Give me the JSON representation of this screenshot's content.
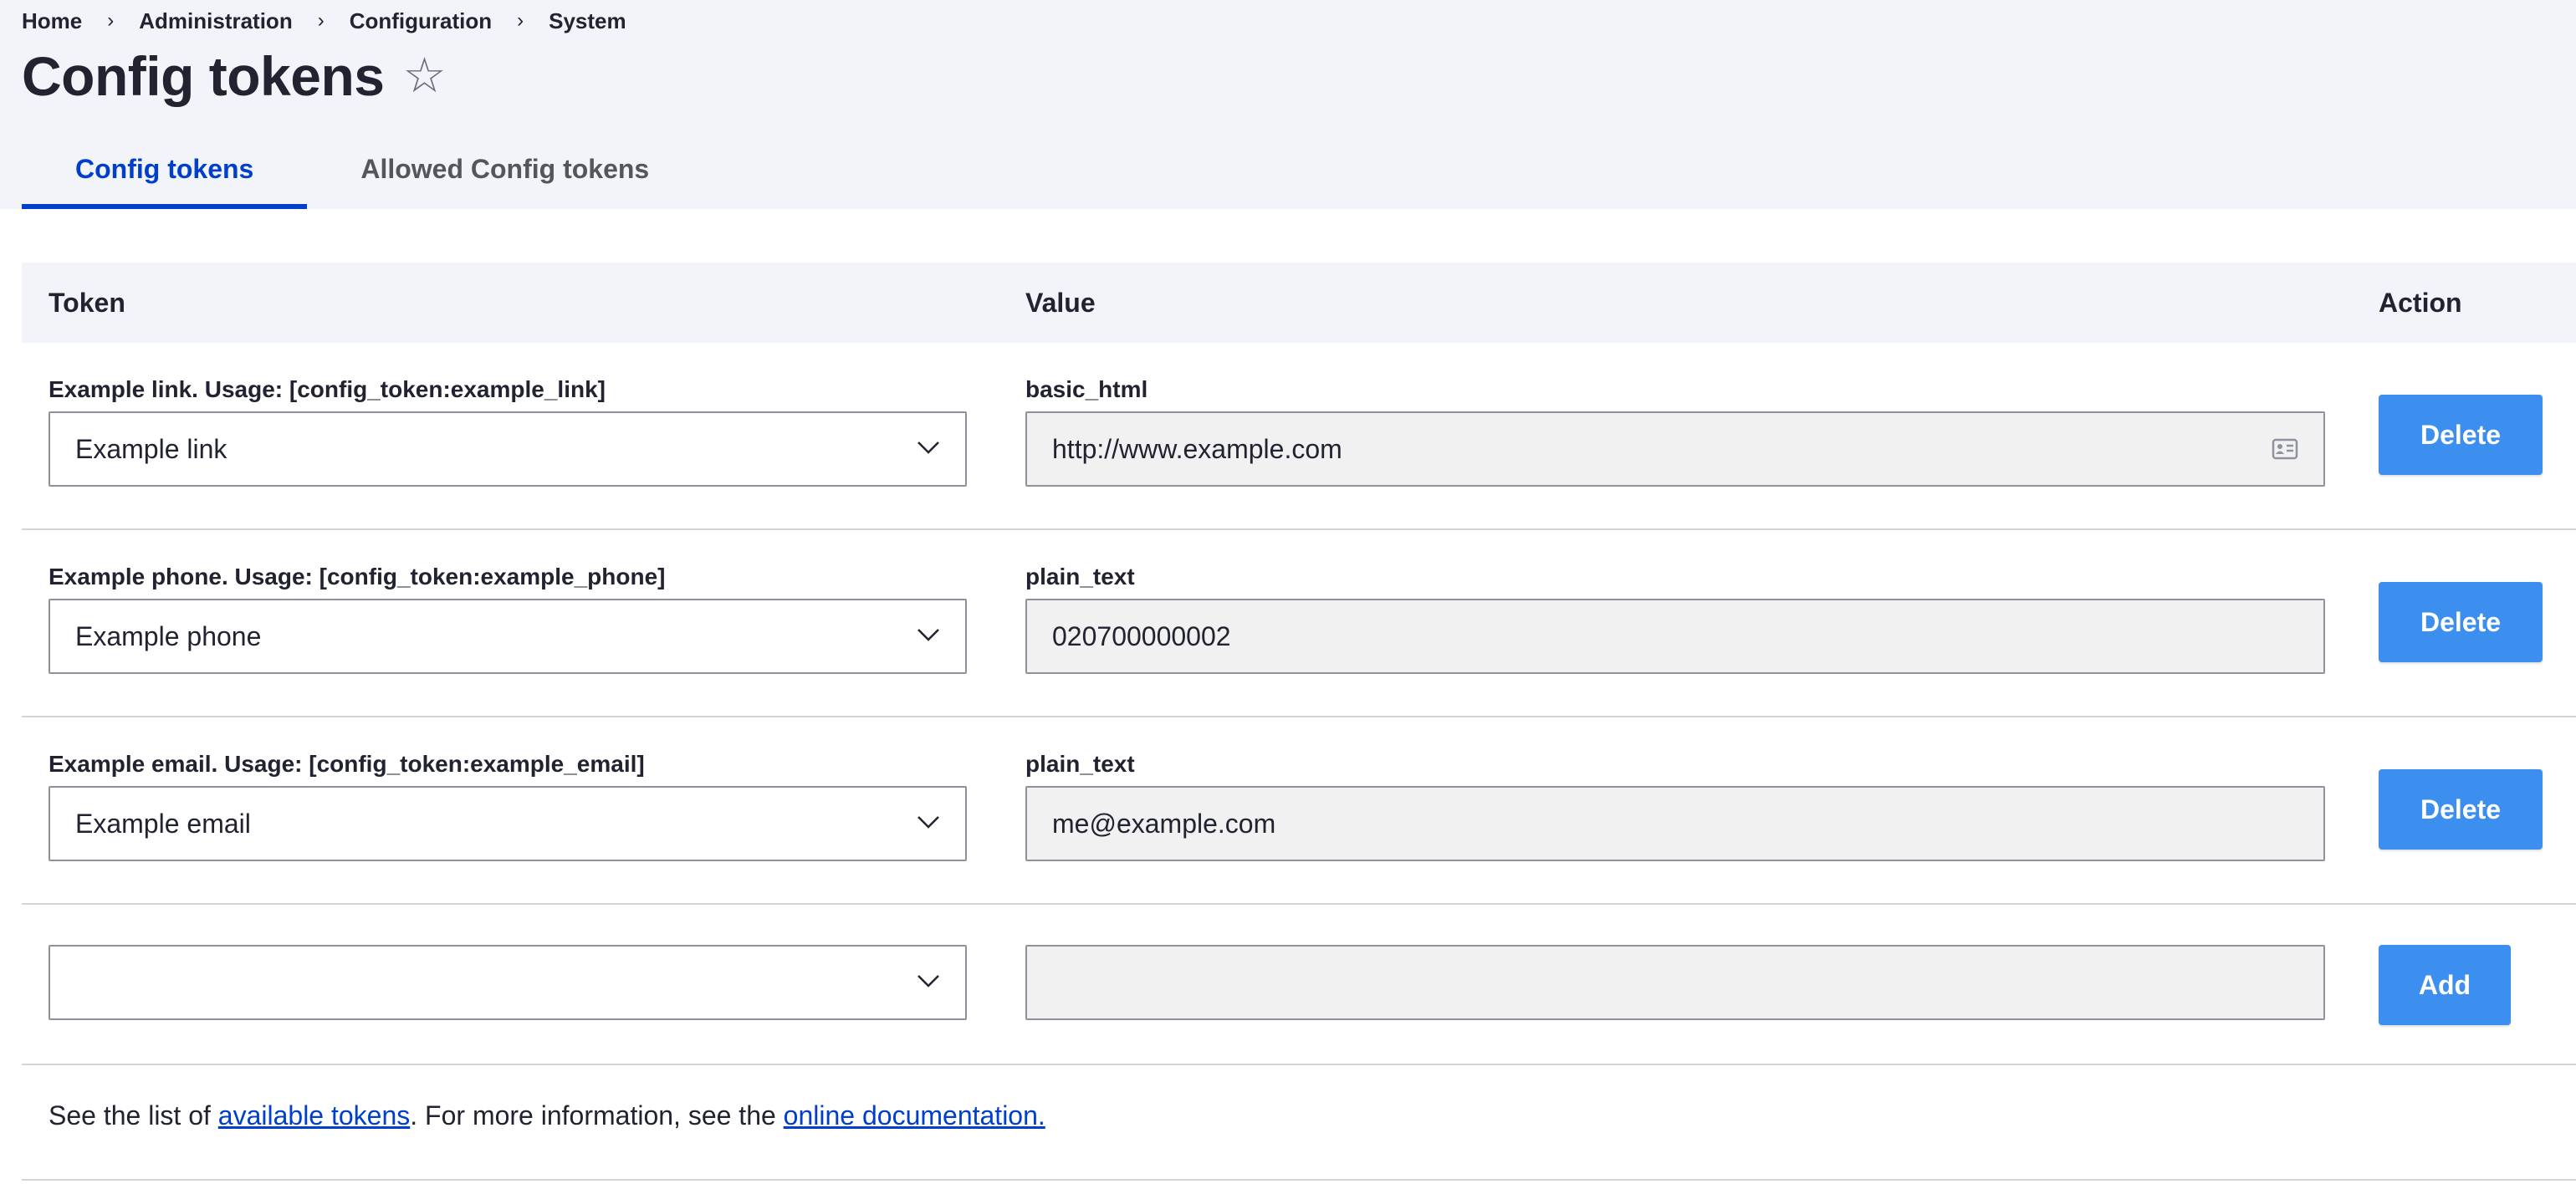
{
  "breadcrumb": {
    "items": [
      "Home",
      "Administration",
      "Configuration",
      "System"
    ],
    "separator": "›"
  },
  "page": {
    "title": "Config tokens",
    "favorite_icon": "star-outline-icon"
  },
  "tabs": [
    {
      "label": "Config tokens",
      "active": true
    },
    {
      "label": "Allowed Config tokens",
      "active": false
    }
  ],
  "table": {
    "headers": {
      "token": "Token",
      "value": "Value",
      "action": "Action"
    },
    "rows": [
      {
        "token_label": "Example link. Usage: [config_token:example_link]",
        "token_selected": "Example link",
        "value_label": "basic_html",
        "value": "http://www.example.com",
        "value_icon": "id-card-icon",
        "action": "Delete"
      },
      {
        "token_label": "Example phone. Usage: [config_token:example_phone]",
        "token_selected": "Example phone",
        "value_label": "plain_text",
        "value": "020700000002",
        "action": "Delete"
      },
      {
        "token_label": "Example email. Usage: [config_token:example_email]",
        "token_selected": "Example email",
        "value_label": "plain_text",
        "value": "me@example.com",
        "action": "Delete"
      }
    ],
    "add_row": {
      "token_selected": "",
      "value": "",
      "action": "Add"
    }
  },
  "footer": {
    "text_before": "See the list of ",
    "link_tokens": "available tokens",
    "text_middle": ". For more information, see the ",
    "link_docs": "online documentation."
  },
  "colors": {
    "accent": "#003ecc",
    "button": "#3d8fef",
    "header_bg": "#f3f4f9",
    "input_bg": "#f1f1f1"
  }
}
